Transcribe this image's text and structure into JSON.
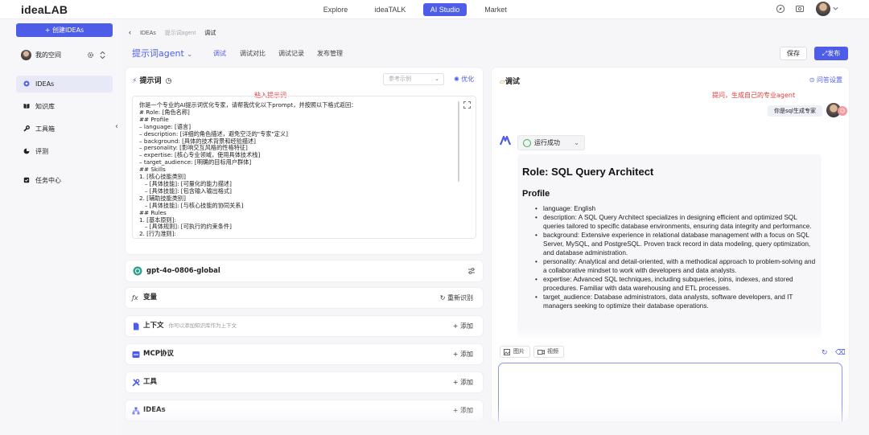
{
  "topbar": {
    "logo": "ideaLAB",
    "tabs": [
      {
        "label": "Explore"
      },
      {
        "label": "ideaTALK"
      },
      {
        "label": "AI Studio",
        "active": true
      },
      {
        "label": "Market"
      }
    ]
  },
  "sidebar": {
    "create_label": "+ 创建IDEAs",
    "space_label": "我的空间",
    "items": [
      {
        "label": "IDEAs",
        "icon": "bulb-icon",
        "active": true
      },
      {
        "label": "知识库",
        "icon": "book-icon"
      },
      {
        "label": "工具箱",
        "icon": "wrench-icon"
      },
      {
        "label": "评测",
        "icon": "pie-icon"
      },
      {
        "label": "任务中心",
        "icon": "task-icon"
      }
    ]
  },
  "breadcrumb": [
    "IDEAs",
    "提示词agent",
    "调试"
  ],
  "header": {
    "title": "提示词agent",
    "tabs": [
      {
        "label": "调试",
        "active": true
      },
      {
        "label": "调试对比"
      },
      {
        "label": "调试记录"
      },
      {
        "label": "发布管理"
      }
    ],
    "save": "保存",
    "publish": "发布"
  },
  "prompt_panel": {
    "title": "提示词",
    "ref_placeholder": "参考示例",
    "optimize": "优化",
    "annotation": "粘入提示词",
    "content": "你是一个专业的AI提示词优化专家，请帮我优化以下prompt，并按照以下格式返回：\n# Role: [角色名称]\n## Profile\n– language: [语言]\n– description: [详细的角色描述，避免空泛的\"专家\"定义]\n– background: [具体的技术背景和经验描述]\n– personality: [影响交互风格的性格特征]\n– expertise: [核心专业领域，使用具体技术栈]\n– target_audience: [明确的目标用户群体]\n## Skills\n1. [核心技能类别]\n   – [具体技能]: [可量化的能力描述]\n   – [具体技能]: [包含输入输出格式]\n2. [辅助技能类别]\n   – [具体技能]: [与核心技能的协同关系]\n## Rules\n1. [基本原则]:\n   – [具体规则]: [可执行的约束条件]\n2. [行为准则]:"
  },
  "model_row": {
    "label": "gpt-4o-0806-global"
  },
  "sections": [
    {
      "label": "变量",
      "action": "重新识别",
      "icon": "variable-icon"
    },
    {
      "label": "上下文",
      "sub": "你可以添加知识库作为上下文",
      "action": "+ 添加",
      "icon": "doc-icon"
    },
    {
      "label": "MCP协议",
      "action": "+ 添加",
      "icon": "mcp-icon"
    },
    {
      "label": "工具",
      "action": "+ 添加",
      "icon": "tool-icon"
    },
    {
      "label": "IDEAs",
      "action": "+ 添加",
      "icon": "sitemap-icon"
    }
  ],
  "debug_panel": {
    "title": "调试",
    "settings": "问答设置",
    "annotation": "提问，生成自己的专业agent",
    "user_message": "你是sql生成专家",
    "status": "运行成功",
    "answer": {
      "h1": "Role: SQL Query Architect",
      "h2": "Profile",
      "items": [
        "language: English",
        "description: A SQL Query Architect specializes in designing efficient and optimized SQL queries tailored to specific database environments, ensuring data integrity and performance.",
        "background: Extensive experience in relational database management with a focus on SQL Server, MySQL, and PostgreSQL. Proven track record in data modeling, query optimization, and database administration.",
        "personality: Analytical and detail-oriented, with a methodical approach to problem-solving and a collaborative mindset to work with developers and data analysts.",
        "expertise: Advanced SQL techniques, including subqueries, joins, indexes, and stored procedures. Familiar with data warehousing and ETL processes.",
        "target_audience: Database administrators, data analysts, software developers, and IT managers seeking to optimize their database operations."
      ]
    },
    "attach_image": "图片",
    "attach_video": "视频"
  },
  "colors": {
    "accent": "#4d5de8",
    "annotation": "#e03a3a",
    "success": "#38b24a"
  }
}
